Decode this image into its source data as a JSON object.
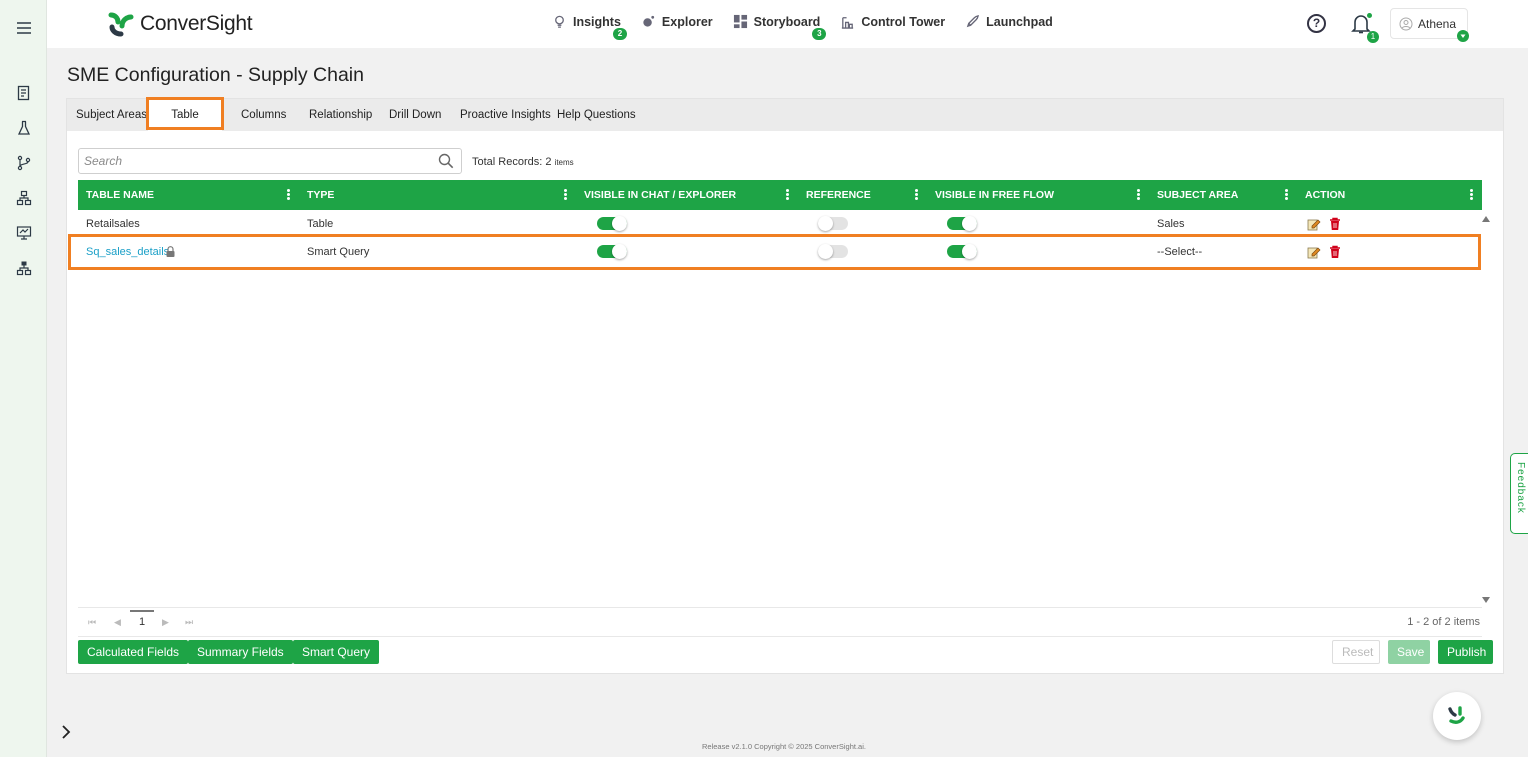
{
  "brand": {
    "name": "ConverSight",
    "accent": "#1ea446",
    "highlight": "#f07f22"
  },
  "nav": {
    "items": [
      {
        "label": "Insights",
        "icon": "lightbulb-icon",
        "badge": "2"
      },
      {
        "label": "Explorer",
        "icon": "explorer-icon",
        "badge": ""
      },
      {
        "label": "Storyboard",
        "icon": "storyboard-icon",
        "badge": "3"
      },
      {
        "label": "Control Tower",
        "icon": "control-tower-icon",
        "badge": ""
      },
      {
        "label": "Launchpad",
        "icon": "rocket-icon",
        "badge": ""
      }
    ]
  },
  "header": {
    "help": "?",
    "notification_count": "1",
    "user_name": "Athena"
  },
  "page": {
    "title": "SME Configuration - Supply Chain"
  },
  "tabs": [
    {
      "label": "Subject Areas"
    },
    {
      "label": "Table",
      "active": true
    },
    {
      "label": "Columns"
    },
    {
      "label": "Relationship"
    },
    {
      "label": "Drill Down"
    },
    {
      "label": "Proactive Insights"
    },
    {
      "label": "Help Questions"
    }
  ],
  "search": {
    "placeholder": "Search",
    "value": ""
  },
  "total": {
    "label": "Total Records: 2",
    "unit": "items"
  },
  "table": {
    "columns": [
      "TABLE NAME",
      "TYPE",
      "VISIBLE IN CHAT / EXPLORER",
      "REFERENCE",
      "VISIBLE IN FREE FLOW",
      "SUBJECT AREA",
      "ACTION"
    ],
    "rows": [
      {
        "name": "Retailsales",
        "type": "Table",
        "visible_chat": true,
        "reference": false,
        "free_flow": true,
        "subject_area": "Sales",
        "locked": false
      },
      {
        "name": "Sq_sales_details",
        "type": "Smart Query",
        "visible_chat": true,
        "reference": false,
        "free_flow": true,
        "subject_area": "--Select--",
        "locked": true
      }
    ]
  },
  "pager": {
    "page": "1",
    "info": "1 - 2 of 2 items"
  },
  "buttons": {
    "calculated": "Calculated Fields",
    "summary": "Summary Fields",
    "smart_query": "Smart Query",
    "reset": "Reset",
    "save": "Save",
    "publish": "Publish"
  },
  "feedback": "Feedback",
  "footer": "Release v2.1.0 Copyright © 2025 ConverSight.ai."
}
